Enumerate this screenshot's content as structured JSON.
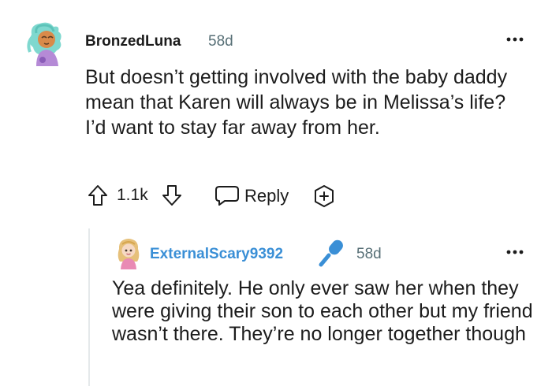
{
  "comment": {
    "username": "BronzedLuna",
    "age": "58d",
    "text": "But doesn’t getting involved with the baby daddy mean that Karen will always be in Melissa’s life? I’d want to stay far away from her.",
    "score": "1.1k",
    "reply_label": "Reply",
    "icons": {
      "avatar": "avatar-illustration",
      "upvote": "upvote-arrow-icon",
      "downvote": "downvote-arrow-icon",
      "reply": "speech-bubble-icon",
      "award": "award-plus-icon",
      "more": "more-dots-icon"
    }
  },
  "reply": {
    "username": "ExternalScary9392",
    "age": "58d",
    "text": "Yea definitely. He only ever saw her when they were giving their son to each other but my friend wasn’t there. They’re no longer together though",
    "icons": {
      "avatar": "avatar-illustration",
      "badge": "microphone-icon",
      "more": "more-dots-icon"
    }
  },
  "colors": {
    "username_reply": "#3a8fd6",
    "meta": "#576f76",
    "text": "#1c1c1c",
    "thread_line": "#e5e9eb"
  }
}
